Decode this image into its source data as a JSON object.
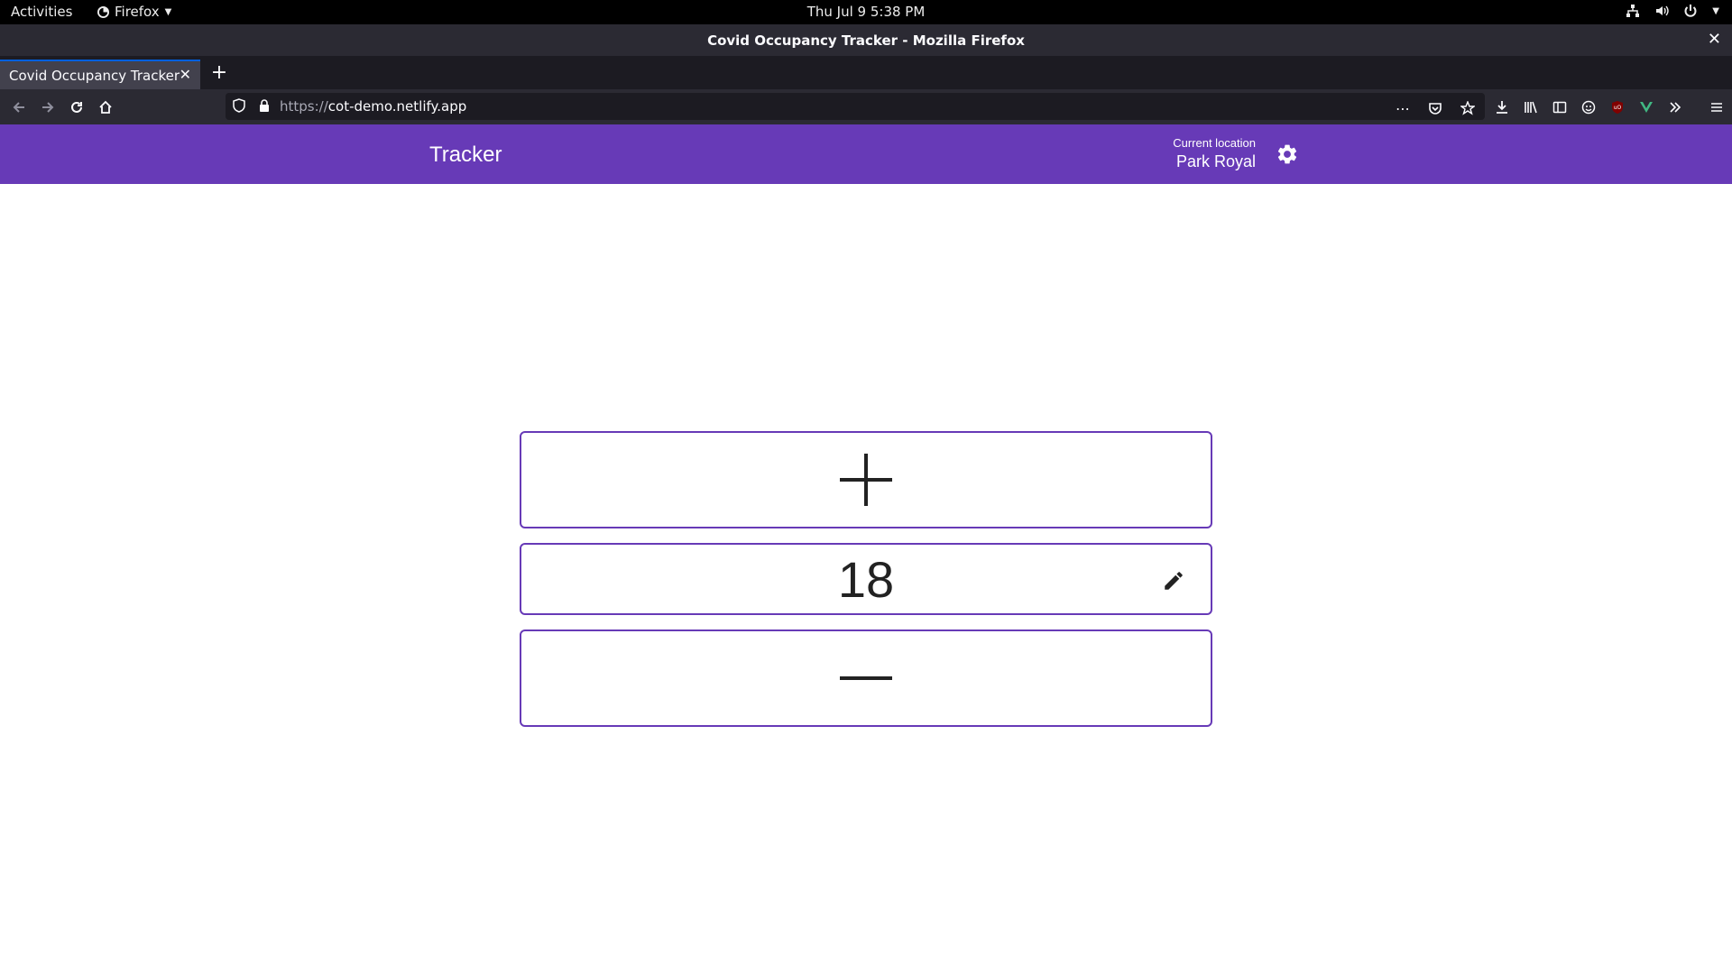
{
  "system": {
    "activities": "Activities",
    "app_menu": "Firefox",
    "clock": "Thu Jul 9   5:38 PM"
  },
  "window": {
    "title": "Covid Occupancy Tracker - Mozilla Firefox"
  },
  "tabs": [
    {
      "label": "Covid Occupancy Tracker",
      "active": true
    }
  ],
  "urlbar": {
    "scheme": "https://",
    "host": "cot-demo.netlify.app"
  },
  "app": {
    "title": "Tracker",
    "location_label": "Current location",
    "location_value": "Park Royal",
    "accent": "#673ab7"
  },
  "counter": {
    "value": "18"
  },
  "icons": [
    "firefox-icon",
    "network-icon",
    "volume-icon",
    "power-icon",
    "back-icon",
    "forward-icon",
    "reload-icon",
    "home-icon",
    "shield-icon",
    "lock-icon",
    "more-icon",
    "pocket-icon",
    "bookmark-star-icon",
    "download-icon",
    "library-icon",
    "sidebar-icon",
    "account-icon",
    "ublock-icon",
    "vue-devtools-icon",
    "overflow-icon",
    "hamburger-menu-icon",
    "settings-gear-icon",
    "plus-icon",
    "pencil-icon",
    "minus-icon"
  ]
}
